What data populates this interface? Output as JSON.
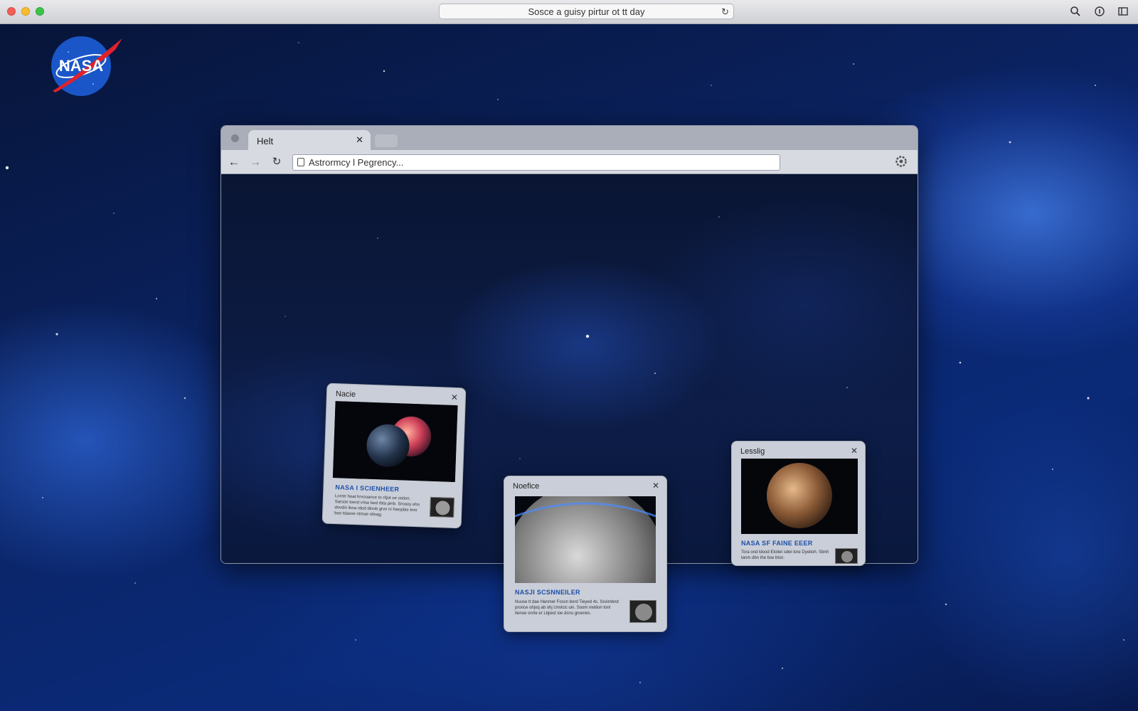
{
  "os_bar": {
    "address_text": "Sosce a guisy pirtur ot tt day",
    "icons": [
      "reload-icon",
      "search-icon",
      "info-icon",
      "sidebar-icon"
    ]
  },
  "logo": {
    "text": "NASA"
  },
  "browser": {
    "tab": {
      "title": "Helt"
    },
    "url": "Astrormcy l Pegrency..."
  },
  "cards": [
    {
      "header": "Nacie",
      "title": "NASA I SCIENHEER",
      "text": "Lorrer hoat hrvooance to ritjot oe ostion. Sarsoe toerd vrise bed rbta pinb. Sroaoy eho dovdin ibna rdod dinob grve ni hwopbie tnm bao tdasoe ntmae nlinag."
    },
    {
      "header": "Noefice",
      "title": "NASJI SCSNNEILER",
      "text": "Nuuse tt dae Hanmer Fossn bord Tieyed 4s. Ssvimbnd pronce ohjoq ab ohj Unvlcic uin. Soom nwtiion tont tienoe onrte er Lbjiest ioe dsnu groenes."
    },
    {
      "header": "Lesslig",
      "title": "NASA SF FAINE EEER",
      "text": "Tora ond ldood Etoliet sdwi tore Dyeitoh. Sbnh tanm dbn the bse btsn."
    }
  ]
}
